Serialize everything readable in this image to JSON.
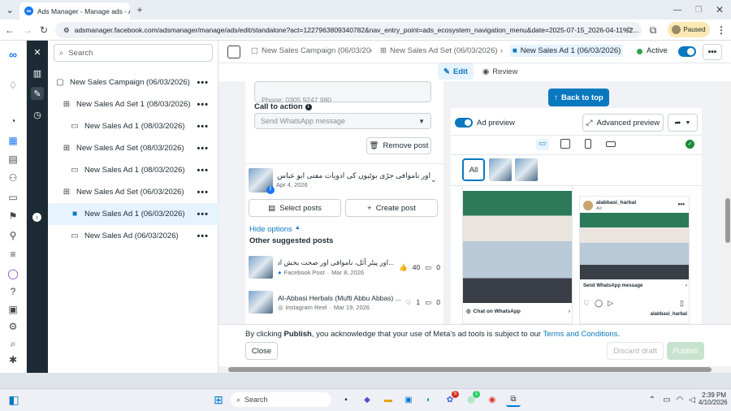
{
  "browser": {
    "tab_title": "Ads Manager - Manage ads - A",
    "url": "adsmanager.facebook.com/adsmanager/manage/ads/edit/standalone?act=1227963809340782&nav_entry_point=ads_ecosystem_navigation_menu&date=2025-07-15_2026-04-11%2...",
    "profile_status": "Paused"
  },
  "search": {
    "placeholder": "Search"
  },
  "tree": [
    {
      "label": "New Sales Campaign (06/03/2026)",
      "icon": "folder-icon"
    },
    {
      "label": "New Sales Ad Set 1 (08/03/2026)",
      "icon": "grid-icon"
    },
    {
      "label": "New Sales Ad 1 (08/03/2026)",
      "icon": "ad-icon"
    },
    {
      "label": "New Sales Ad Set (08/03/2026)",
      "icon": "grid-icon"
    },
    {
      "label": "New Sales Ad 1 (08/03/2026)",
      "icon": "ad-icon"
    },
    {
      "label": "New Sales Ad Set (06/03/2026)",
      "icon": "grid-icon"
    },
    {
      "label": "New Sales Ad 1 (06/03/2026)",
      "icon": "ad-icon"
    },
    {
      "label": "New Sales Ad (06/03/2026)",
      "icon": "ad-icon"
    }
  ],
  "breadcrumb": {
    "campaign": "New Sales Campaign (06/03/20",
    "adset": "New Sales Ad Set (06/03/2026)",
    "ad": "New Sales Ad 1 (06/03/2026)",
    "status": "Active"
  },
  "mode": {
    "edit": "Edit",
    "review": "Review"
  },
  "editor": {
    "phone_label": "Phone: 0305 9247 980",
    "cta_label": "Call to action",
    "cta_value": "Send WhatsApp message",
    "remove_post": "Remove post",
    "post_title": "اور ناموافی جڑی بوٹیوں کی ادویات مفتی ابو عباس سے...",
    "post_date": "Apr 4, 2026",
    "select_posts": "Select posts",
    "create_post": "Create post",
    "hide_options": "Hide options",
    "suggested_heading": "Other suggested posts",
    "suggested": [
      {
        "title": "...اور پیٹر آئل، ناموافی اور صحت بخش ادویات",
        "source": "Facebook Post",
        "date": "Mar 8, 2026",
        "likes": "40",
        "comments": "0"
      },
      {
        "title": "Al-Abbasi Herbals (Mufti Abbu Abbas) ...",
        "source": "Instagram Reel",
        "date": "Mar 19, 2026",
        "likes": "1",
        "comments": "0"
      }
    ]
  },
  "preview": {
    "back_to_top": "Back to top",
    "ad_preview": "Ad preview",
    "advanced_preview": "Advanced preview",
    "filter_all": "All",
    "left_cta": "Chat on WhatsApp",
    "right_account": "alabbasi_harbal",
    "right_sub": "Ad",
    "right_cta": "Send WhatsApp message",
    "right_caption": "alabbasi_harbal"
  },
  "footer": {
    "notice_pre": "By clicking ",
    "notice_bold": "Publish",
    "notice_post": ", you acknowledge that your use of Meta's ad tools is subject to our ",
    "notice_link": "Terms and Conditions",
    "notice_end": ".",
    "close": "Close",
    "discard": "Discard draft",
    "publish": "Publish"
  },
  "taskbar": {
    "search": "Search",
    "time": "2:39 PM",
    "date": "4/10/2026",
    "badge_a": "5",
    "badge_b": "1"
  },
  "colors": {
    "accent": "#0a78be",
    "meta_blue": "#1877f2",
    "active_green": "#31a24c"
  }
}
